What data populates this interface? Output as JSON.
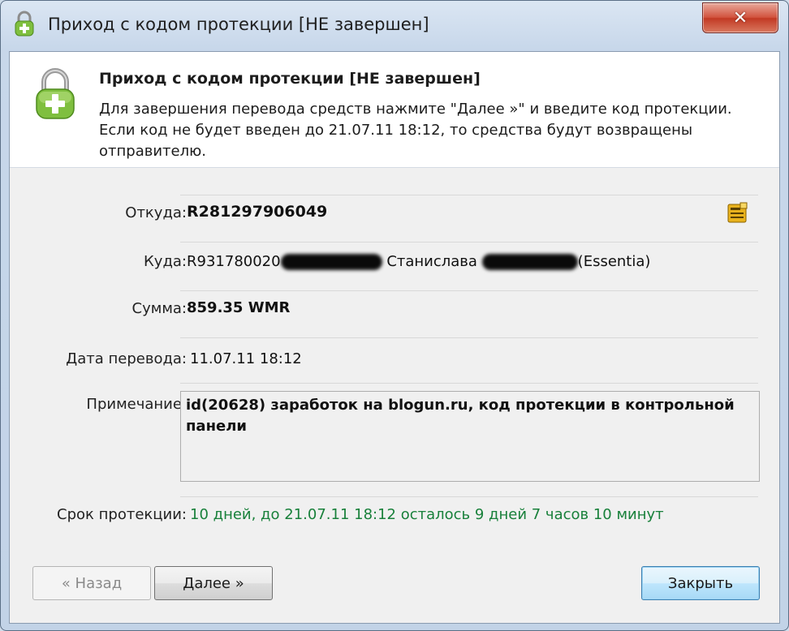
{
  "window": {
    "title": "Приход с кодом протекции [НЕ завершен]",
    "close_label": "✕"
  },
  "header": {
    "title": "Приход с кодом протекции [НЕ завершен]",
    "description": "Для завершения перевода средств нажмите \"Далее »\" и введите код протекции. Если код не будет введен до 21.07.11 18:12, то средства будут возвращены отправителю."
  },
  "fields": {
    "from": {
      "label": "Откуда:",
      "value": "R281297906049"
    },
    "to": {
      "label": "Куда:",
      "purse_prefix": "R931780020",
      "name": "Станислава",
      "suffix": "(Essentia)"
    },
    "amount": {
      "label": "Сумма:",
      "value": "859.35 WMR"
    },
    "date": {
      "label": "Дата перевода:",
      "value": "11.07.11 18:12"
    },
    "note": {
      "label": "Примечание:",
      "value": "id(20628) заработок на blogun.ru, код протекции в контрольной панели"
    },
    "protection": {
      "label": "Срок протекции:",
      "value": "10 дней, до 21.07.11 18:12 осталось 9 дней 7 часов 10 минут"
    }
  },
  "buttons": {
    "back": "« Назад",
    "next": "Далее »",
    "close": "Закрыть"
  },
  "colors": {
    "protection_text": "#18803a",
    "lock_icon": "#7fbf3f",
    "close_button": "#c23a24"
  },
  "icons": {
    "title": "lock-plus-icon",
    "header": "lock-plus-icon",
    "from_action": "purse-card-icon"
  }
}
